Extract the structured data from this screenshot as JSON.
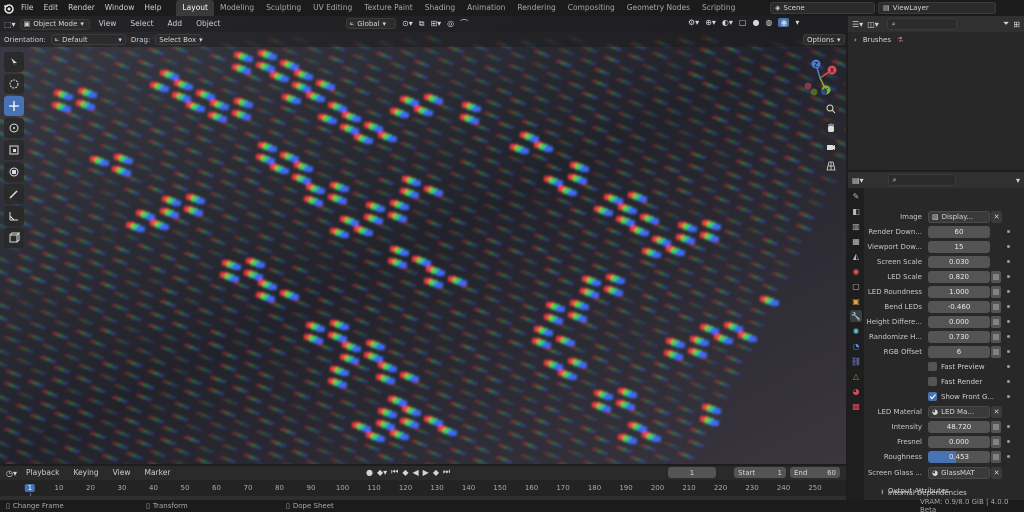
{
  "menu": [
    "File",
    "Edit",
    "Render",
    "Window",
    "Help"
  ],
  "workspaces": [
    "Layout",
    "Modeling",
    "Sculpting",
    "UV Editing",
    "Texture Paint",
    "Shading",
    "Animation",
    "Rendering",
    "Compositing",
    "Geometry Nodes",
    "Scripting"
  ],
  "active_workspace": "Layout",
  "scene": "Scene",
  "view_layer": "ViewLayer",
  "viewport": {
    "mode": "Object Mode",
    "header_menu": [
      "View",
      "Select",
      "Add",
      "Object"
    ],
    "transform_orientation": "Global",
    "orientation_label": "Orientation:",
    "orientation_value": "Default",
    "drag_label": "Drag:",
    "drag_value": "Select Box",
    "options_label": "Options",
    "gizmo": {
      "x": "X",
      "y": "Y",
      "z": "Z"
    }
  },
  "outliner": {
    "item": "Brushes"
  },
  "properties": {
    "image_label": "Image",
    "image_value": "Display...",
    "rows": [
      {
        "label": "Render Down...",
        "value": "60"
      },
      {
        "label": "Viewport Dow...",
        "value": "15"
      },
      {
        "label": "Screen Scale",
        "value": "0.030"
      },
      {
        "label": "LED Scale",
        "value": "0.820"
      },
      {
        "label": "LED Roundness",
        "value": "1.000"
      },
      {
        "label": "Bend LEDs",
        "value": "-0.460"
      },
      {
        "label": "Height Differe...",
        "value": "0.000"
      },
      {
        "label": "Randomize H...",
        "value": "0.730"
      },
      {
        "label": "RGB Offset",
        "value": "6"
      }
    ],
    "checks": [
      {
        "label": "Fast Preview",
        "checked": false
      },
      {
        "label": "Fast Render",
        "checked": false
      },
      {
        "label": "Show Front G...",
        "checked": true
      }
    ],
    "led_material_label": "LED Material",
    "led_material_value": "LED Ma...",
    "rows2": [
      {
        "label": "Intensity",
        "value": "48.720"
      },
      {
        "label": "Fresnel",
        "value": "0.000"
      },
      {
        "label": "Roughness",
        "value": "0.453",
        "fill": 0.453
      }
    ],
    "screen_glass_label": "Screen Glass ...",
    "screen_glass_value": "GlassMAT",
    "subpanels": [
      "Output Attributes",
      "Internal Dependencies"
    ]
  },
  "timeline": {
    "menu": [
      "Playback",
      "Keying",
      "View",
      "Marker"
    ],
    "current_frame": "1",
    "start_label": "Start",
    "start": "1",
    "end_label": "End",
    "end": "60",
    "ticks": [
      "1",
      "10",
      "20",
      "30",
      "40",
      "50",
      "60",
      "70",
      "80",
      "90",
      "100",
      "110",
      "120",
      "130",
      "140",
      "150",
      "160",
      "170",
      "180",
      "190",
      "200",
      "210",
      "220",
      "230",
      "240",
      "250"
    ]
  },
  "status": {
    "left": "Change Frame",
    "mid": "Transform",
    "right": "Dope Sheet",
    "vram": "VRAM: 0.9/8.0 GiB | 4.0.0 Beta"
  }
}
